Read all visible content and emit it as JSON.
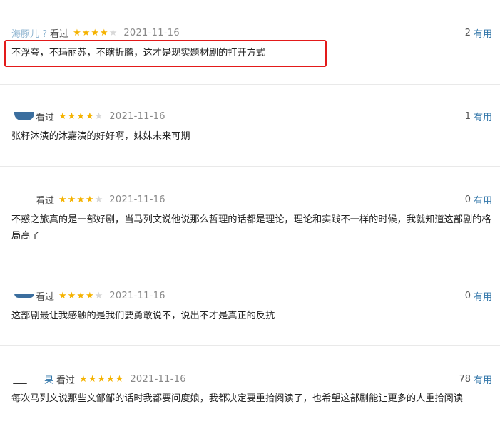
{
  "reviews": [
    {
      "user": "海豚儿 ?",
      "status": "看过",
      "stars": 4,
      "date": "2021-11-16",
      "useful_count": "2",
      "useful_label": "有用",
      "content": "不浮夸，不玛丽苏，不瞎折腾，这才是现实题材剧的打开方式"
    },
    {
      "user": "",
      "status": "看过",
      "stars": 4,
      "date": "2021-11-16",
      "useful_count": "1",
      "useful_label": "有用",
      "content": "张籽沐演的沐嘉演的好好啊，妹妹未来可期"
    },
    {
      "user": "",
      "status": "看过",
      "stars": 4,
      "date": "2021-11-16",
      "useful_count": "0",
      "useful_label": "有用",
      "content": "不惑之旅真的是一部好剧，当马列文说他说那么哲理的话都是理论，理论和实践不一样的时候，我就知道这部剧的格局高了"
    },
    {
      "user": "",
      "status": "看过",
      "stars": 4,
      "date": "2021-11-16",
      "useful_count": "0",
      "useful_label": "有用",
      "content": "这部剧最让我感触的是我们要勇敢说不，说出不才是真正的反抗"
    },
    {
      "user": "果",
      "status": "看过",
      "stars": 5,
      "date": "2021-11-16",
      "useful_count": "78",
      "useful_label": "有用",
      "content": "每次马列文说那些文邹邹的话时我都要问度娘，我都决定要重拾阅读了，也希望这部剧能让更多的人重拾阅读"
    }
  ],
  "colors": {
    "link": "#3377aa",
    "star_on": "#f5b301",
    "star_off": "#d8d8d8",
    "highlight": "#e31a1a"
  }
}
